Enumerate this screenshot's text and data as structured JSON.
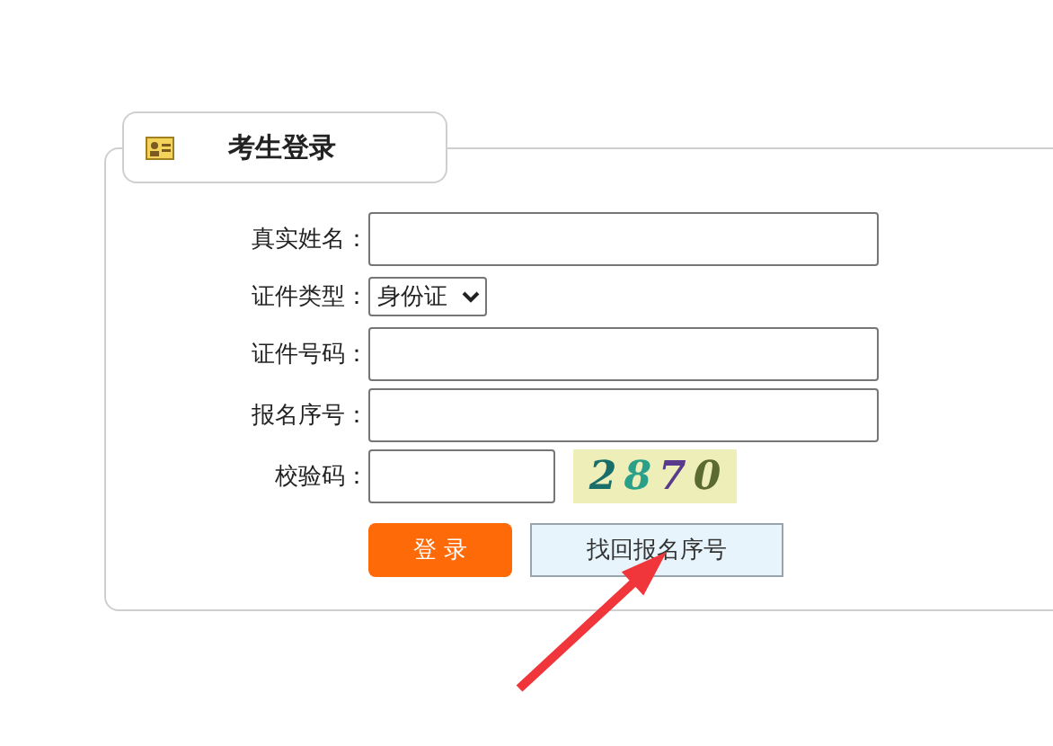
{
  "panel": {
    "title": "考生登录"
  },
  "fields": [
    {
      "kind": "text",
      "label": "真实姓名："
    },
    {
      "kind": "select",
      "label": "证件类型：",
      "value": "身份证"
    },
    {
      "kind": "text",
      "label": "证件号码："
    },
    {
      "kind": "text",
      "label": "报名序号："
    },
    {
      "kind": "captcha",
      "label": "校验码：",
      "captcha": "2870"
    }
  ],
  "buttons": [
    {
      "kind": "primary",
      "label": "登 录"
    },
    {
      "kind": "secondary",
      "label": "找回报名序号"
    }
  ]
}
